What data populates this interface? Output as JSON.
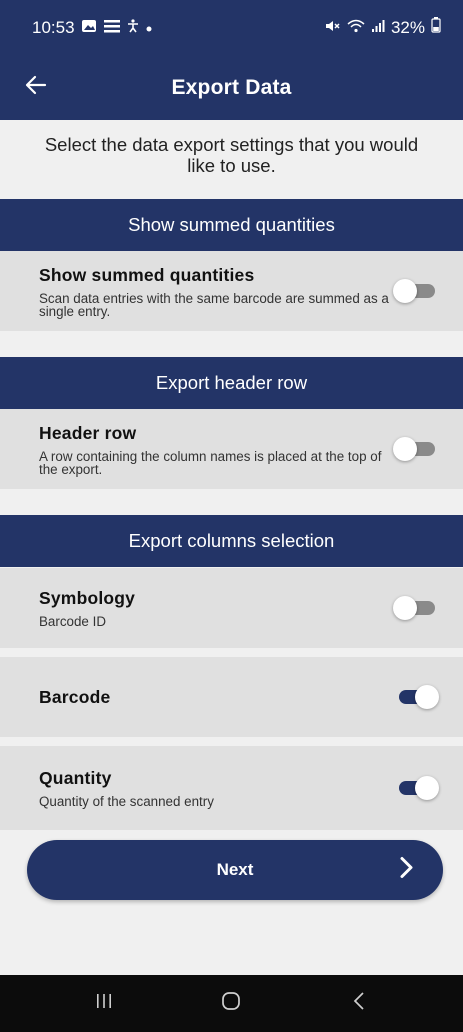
{
  "status_bar": {
    "time": "10:53",
    "battery": "32%"
  },
  "app_bar": {
    "title": "Export Data"
  },
  "intro": {
    "text": "Select the data export settings that you would like to use."
  },
  "sections": {
    "summed": {
      "header": "Show summed quantities",
      "title": "Show summed quantities",
      "subtitle": "Scan data entries with the same barcode are summed as a single entry.",
      "enabled": false
    },
    "header_row": {
      "header": "Export header row",
      "title": "Header row",
      "subtitle": "A row containing the column names is placed at the top of the export.",
      "enabled": false
    },
    "columns": {
      "header": "Export columns selection",
      "items": [
        {
          "title": "Symbology",
          "subtitle": "Barcode ID",
          "enabled": false
        },
        {
          "title": "Barcode",
          "subtitle": "",
          "enabled": true
        },
        {
          "title": "Quantity",
          "subtitle": "Quantity of the scanned entry",
          "enabled": true
        }
      ]
    }
  },
  "next_button": {
    "label": "Next"
  },
  "colors": {
    "primary": "#233467",
    "row_bg": "#e0e0e0",
    "page_bg": "#f0f0f0",
    "toggle_off": "#8a8a8a"
  }
}
